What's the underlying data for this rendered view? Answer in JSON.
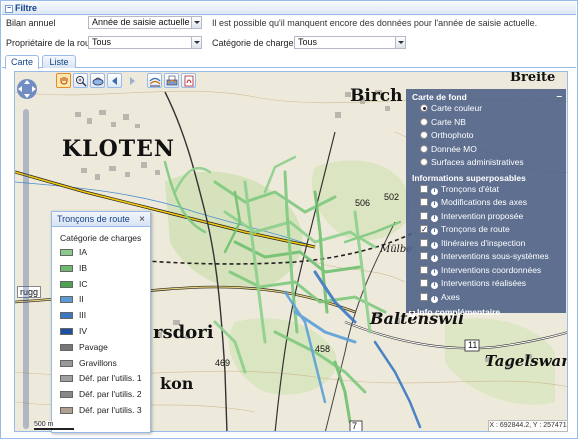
{
  "filter": {
    "title": "Filtre",
    "bilan_label": "Bilan annuel",
    "bilan_value": "Année de saisie actuelle",
    "note": "Il est possible qu'il manquent encore des données pour l'année de saisie actuelle.",
    "owner_label": "Propriétaire de la route",
    "owner_value": "Tous",
    "category_label": "Catégorie de charges",
    "category_value": "Tous"
  },
  "tabs": [
    {
      "label": "Carte",
      "active": true
    },
    {
      "label": "Liste",
      "active": false
    }
  ],
  "toolbar": {
    "tools": [
      "pan-icon",
      "zoom-in-icon",
      "zoom-extent-icon",
      "back-icon",
      "forward-icon",
      "layers-icon",
      "print-icon",
      "pdf-icon"
    ]
  },
  "map": {
    "places": [
      "KLOTEN",
      "Birch",
      "rsdori",
      "Baltenswil",
      "Tagelswangen",
      "kon",
      "rugg",
      "Mülbe",
      "Breite"
    ],
    "numbers": [
      "506",
      "502",
      "458",
      "469",
      "11",
      "7"
    ],
    "scale": "500 m",
    "coords": "X : 692844.2, Y : 257471"
  },
  "layers": {
    "base_title": "Carte de fond",
    "base": [
      {
        "label": "Carte couleur",
        "selected": true
      },
      {
        "label": "Carte NB",
        "selected": false
      },
      {
        "label": "Orthophoto",
        "selected": false
      },
      {
        "label": "Donnée MO",
        "selected": false
      },
      {
        "label": "Surfaces administratives",
        "selected": false
      }
    ],
    "overlay_title": "Informations superposables",
    "overlays": [
      {
        "label": "Tronçons d'état",
        "checked": false
      },
      {
        "label": "Modifications des axes",
        "checked": false
      },
      {
        "label": "Intervention proposée",
        "checked": false
      },
      {
        "label": "Tronçons de route",
        "checked": true
      },
      {
        "label": "Itinéraires d'inspection",
        "checked": false
      },
      {
        "label": "Interventions sous-systèmes",
        "checked": false
      },
      {
        "label": "Interventions coordonnées",
        "checked": false
      },
      {
        "label": "Interventions réalisées",
        "checked": false
      },
      {
        "label": "Axes",
        "checked": false
      }
    ],
    "more": "Info complémentaire"
  },
  "legend": {
    "title": "Tronçons de route",
    "subtitle": "Catégorie de charges",
    "items": [
      {
        "label": "IA",
        "color": "#8cc98c"
      },
      {
        "label": "IB",
        "color": "#6fb96f"
      },
      {
        "label": "IC",
        "color": "#4fa04f"
      },
      {
        "label": "II",
        "color": "#5a9ad6"
      },
      {
        "label": "III",
        "color": "#3a78c2"
      },
      {
        "label": "IV",
        "color": "#1f4fa0"
      },
      {
        "label": "Pavage",
        "color": "#777777"
      },
      {
        "label": "Gravillons",
        "color": "#999999"
      },
      {
        "label": "Déf. par l'utilis. 1",
        "color": "#a0a0a0"
      },
      {
        "label": "Déf. par l'utilis. 2",
        "color": "#888888"
      },
      {
        "label": "Déf. par l'utilis. 3",
        "color": "#b0a090"
      }
    ]
  }
}
